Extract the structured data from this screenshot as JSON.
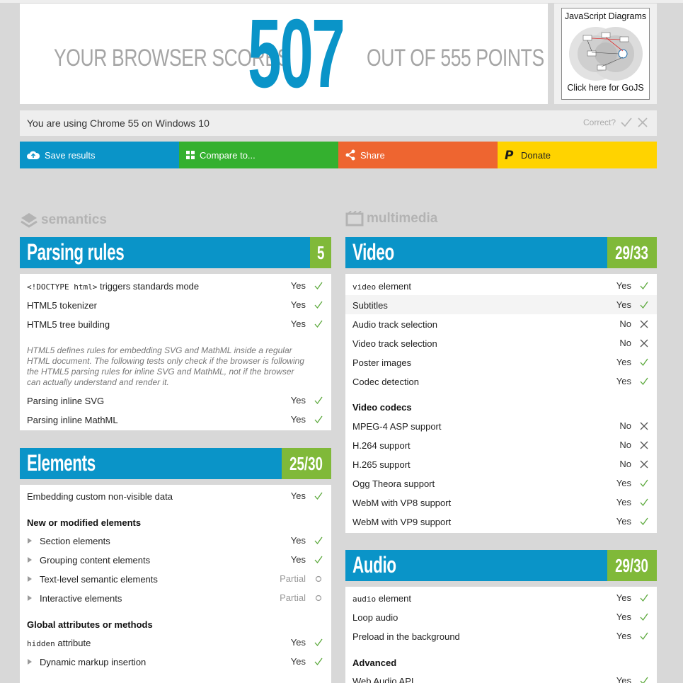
{
  "score": {
    "prefix": "YOUR BROWSER SCORES",
    "value": "507",
    "suffix": "OUT OF 555 POINTS"
  },
  "ad": {
    "title": "JavaScript Diagrams",
    "link": "Click here for GoJS"
  },
  "browser": {
    "text": "You are using Chrome 55 on Windows 10",
    "correct_label": "Correct?"
  },
  "actions": {
    "save": "Save results",
    "compare": "Compare to...",
    "share": "Share",
    "donate": "Donate"
  },
  "categories": {
    "left": "semantics",
    "right": "multimedia"
  },
  "parsing": {
    "title": "Parsing rules",
    "score": "5",
    "rows": [
      {
        "code": "<!DOCTYPE html>",
        "label": " triggers standards mode",
        "result": "Yes"
      },
      {
        "label": "HTML5 tokenizer",
        "result": "Yes"
      },
      {
        "label": "HTML5 tree building",
        "result": "Yes"
      }
    ],
    "note": "HTML5 defines rules for embedding SVG and MathML inside a regular HTML document. The following tests only check if the browser is following the HTML5 parsing rules for inline SVG and MathML, not if the browser can actually understand and render it.",
    "rows2": [
      {
        "label": "Parsing inline SVG",
        "result": "Yes"
      },
      {
        "label": "Parsing inline MathML",
        "result": "Yes"
      }
    ]
  },
  "elements": {
    "title": "Elements",
    "score": "25/30",
    "rows": [
      {
        "label": "Embedding custom non-visible data",
        "result": "Yes"
      }
    ],
    "group1": "New or modified elements",
    "group1_rows": [
      {
        "label": "Section elements",
        "result": "Yes"
      },
      {
        "label": "Grouping content elements",
        "result": "Yes"
      },
      {
        "label": "Text-level semantic elements",
        "result": "Partial"
      },
      {
        "label": "Interactive elements",
        "result": "Partial"
      }
    ],
    "group2": "Global attributes or methods",
    "group2_rows": [
      {
        "code": "hidden",
        "label": " attribute",
        "result": "Yes"
      },
      {
        "label": "Dynamic markup insertion",
        "result": "Yes"
      }
    ]
  },
  "video": {
    "title": "Video",
    "score": "29/33",
    "rows": [
      {
        "code": "video",
        "label": " element",
        "result": "Yes"
      },
      {
        "label": "Subtitles",
        "result": "Yes"
      },
      {
        "label": "Audio track selection",
        "result": "No"
      },
      {
        "label": "Video track selection",
        "result": "No"
      },
      {
        "label": "Poster images",
        "result": "Yes"
      },
      {
        "label": "Codec detection",
        "result": "Yes"
      }
    ],
    "group1": "Video codecs",
    "group1_rows": [
      {
        "label": "MPEG-4 ASP support",
        "result": "No"
      },
      {
        "label": "H.264 support",
        "result": "No"
      },
      {
        "label": "H.265 support",
        "result": "No"
      },
      {
        "label": "Ogg Theora support",
        "result": "Yes"
      },
      {
        "label": "WebM with VP8 support",
        "result": "Yes"
      },
      {
        "label": "WebM with VP9 support",
        "result": "Yes"
      }
    ]
  },
  "audio": {
    "title": "Audio",
    "score": "29/30",
    "rows": [
      {
        "code": "audio",
        "label": " element",
        "result": "Yes"
      },
      {
        "label": "Loop audio",
        "result": "Yes"
      },
      {
        "label": "Preload in the background",
        "result": "Yes"
      }
    ],
    "group1": "Advanced",
    "group1_rows": [
      {
        "label": "Web Audio API",
        "result": "Yes"
      }
    ]
  },
  "colors": {
    "blue": "#0a94c8",
    "green": "#34b02f",
    "orange": "#ee6530",
    "yellow": "#ffd300",
    "score_green": "#80b939"
  }
}
